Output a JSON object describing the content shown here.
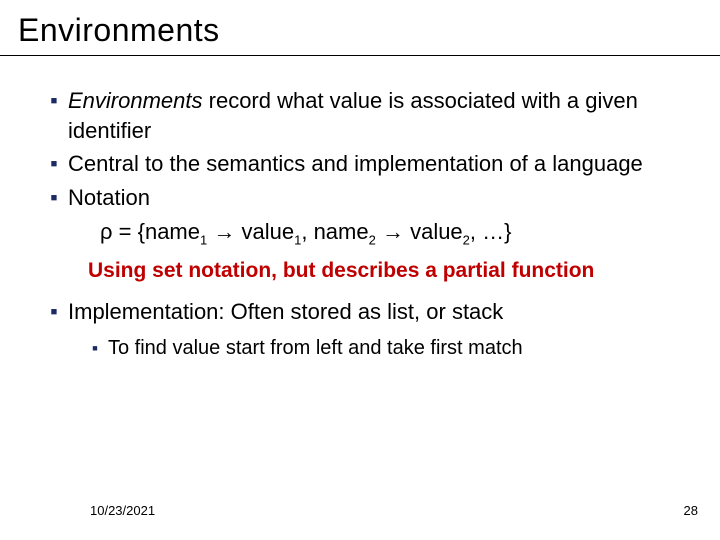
{
  "title": "Environments",
  "bullets": [
    {
      "italic": "Environments",
      "rest": " record what value is associated with a given identifier"
    },
    {
      "text": "Central to the semantics and implementation of a language"
    },
    {
      "text": "Notation"
    },
    {
      "text": "Implementation: Often stored as list, or stack"
    }
  ],
  "notation": {
    "rho": "ρ",
    "eq": " = {",
    "n1": "name",
    "v1": " value",
    "n2": " name",
    "v2": " value",
    "s1": "1",
    "s2": "2",
    "arrow": " → ",
    "comma": ",",
    "tail": ", …}"
  },
  "callout": "Using set notation, but describes a partial function",
  "subbullet": "To find value start from left and take first match",
  "footer": {
    "date": "10/23/2021",
    "page": "28"
  }
}
